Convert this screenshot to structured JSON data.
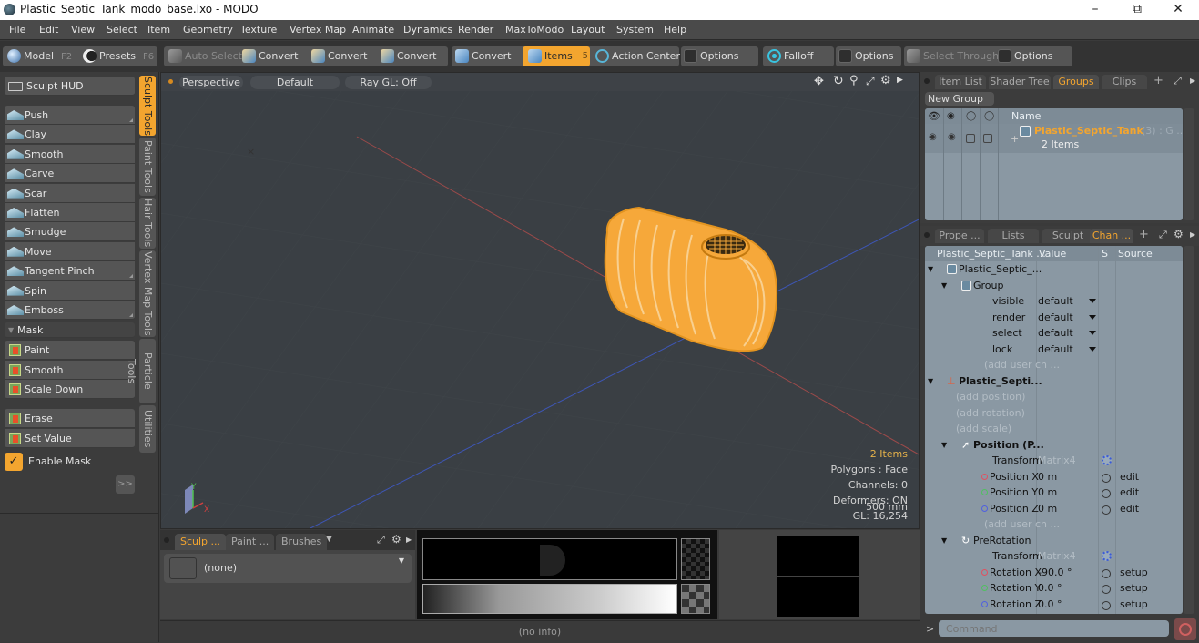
{
  "window": {
    "title": "Plastic_Septic_Tank_modo_base.lxo - MODO",
    "controls": [
      "minimize",
      "restore",
      "close"
    ]
  },
  "menubar": [
    "File",
    "Edit",
    "View",
    "Select",
    "Item",
    "Geometry",
    "Texture",
    "Vertex Map",
    "Animate",
    "Dynamics",
    "Render",
    "MaxToModo",
    "Layout",
    "System",
    "Help"
  ],
  "toolbar": {
    "model": {
      "label": "Model",
      "key": "F2"
    },
    "presets": {
      "label": "Presets",
      "key": "F6"
    },
    "auto_select": "Auto Select",
    "convert_buttons": [
      "Convert",
      "Convert",
      "Convert",
      "Convert"
    ],
    "items": {
      "label": "Items",
      "key": "5"
    },
    "action_center": "Action Center",
    "options1": "Options",
    "falloff": "Falloff",
    "options2": "Options",
    "select_through": "Select Through",
    "options3": "Options"
  },
  "left_panel": {
    "sculpt_hud": "Sculpt HUD",
    "tools": [
      "Push",
      "Clay",
      "Smooth",
      "Carve",
      "Scar",
      "Flatten",
      "Smudge",
      "Move",
      "Tangent Pinch",
      "Spin",
      "Emboss"
    ],
    "mask_header": "Mask",
    "mask_tools": [
      "Paint",
      "Smooth",
      "Scale Down"
    ],
    "mask_tools2": [
      "Erase",
      "Set Value"
    ],
    "enable_mask": {
      "label": "Enable Mask",
      "checked": true
    },
    "expand_label": ">>",
    "vertical_tabs": [
      {
        "label": "Sculpt Tools",
        "active": true
      },
      {
        "label": "Paint Tools",
        "active": false
      },
      {
        "label": "Hair Tools",
        "active": false
      },
      {
        "label": "Vertex Map Tools",
        "active": false
      },
      {
        "label": "Particle Tools",
        "active": false
      },
      {
        "label": "Utilities",
        "active": false
      }
    ]
  },
  "viewport": {
    "view_label": "Perspective",
    "shading_label": "Default",
    "raygl_label": "Ray GL: Off",
    "hud": {
      "items": "2 Items",
      "polygons": "Polygons : Face",
      "channels": "Channels: 0",
      "deformers": "Deformers: ON",
      "gl": "GL: 16,254",
      "scale": "500 mm"
    },
    "axis_labels": {
      "y": "Y",
      "x": "X"
    }
  },
  "bottom_panel": {
    "tabs": [
      {
        "label": "Sculp ...",
        "active": true
      },
      {
        "label": "Paint ...",
        "active": false
      },
      {
        "label": "Brushes",
        "active": false
      }
    ],
    "preset_value": "(none)"
  },
  "statusbar": {
    "info": "(no info)"
  },
  "groups_panel": {
    "tabs": [
      {
        "label": "Item List",
        "active": false
      },
      {
        "label": "Shader Tree",
        "active": false
      },
      {
        "label": "Groups",
        "active": true
      },
      {
        "label": "Clips",
        "active": false
      }
    ],
    "new_group": "New Group",
    "column_name": "Name",
    "group": {
      "name": "Plastic_Septic_Tank",
      "suffix": "(3) : G ...",
      "count": "2 Items"
    }
  },
  "channels_panel": {
    "tabs": [
      {
        "label": "Prope ...",
        "active": false
      },
      {
        "label": "Lists",
        "active": false
      },
      {
        "label": "Sculpt",
        "active": false
      },
      {
        "label": "Chan ...",
        "active": true
      }
    ],
    "columns": [
      "Plastic_Septic_Tank ...",
      "Value",
      "S",
      "Source"
    ],
    "rows": [
      {
        "name": "Plastic_Septic_...",
        "value": "",
        "s": "",
        "source": "",
        "type": "item",
        "indent": 1
      },
      {
        "name": "Group",
        "value": "",
        "s": "",
        "source": "",
        "type": "group",
        "indent": 2
      },
      {
        "name": "visible",
        "value": "default",
        "s": "",
        "source": "",
        "type": "dropdown",
        "indent": 3
      },
      {
        "name": "render",
        "value": "default",
        "s": "",
        "source": "",
        "type": "dropdown",
        "indent": 3
      },
      {
        "name": "select",
        "value": "default",
        "s": "",
        "source": "",
        "type": "dropdown",
        "indent": 3
      },
      {
        "name": "lock",
        "value": "default",
        "s": "",
        "source": "",
        "type": "dropdown",
        "indent": 3
      },
      {
        "name": "(add user ch ...",
        "value": "",
        "s": "",
        "source": "",
        "type": "add",
        "indent": 3
      },
      {
        "name": "Plastic_Septi...",
        "value": "",
        "s": "",
        "source": "",
        "type": "locator",
        "indent": 1
      },
      {
        "name": "(add position)",
        "value": "",
        "s": "",
        "source": "",
        "type": "add",
        "indent": 2
      },
      {
        "name": "(add rotation)",
        "value": "",
        "s": "",
        "source": "",
        "type": "add",
        "indent": 2
      },
      {
        "name": "(add scale)",
        "value": "",
        "s": "",
        "source": "",
        "type": "add",
        "indent": 2
      },
      {
        "name": "Position (P...",
        "value": "",
        "s": "",
        "source": "",
        "type": "xform",
        "indent": 2
      },
      {
        "name": "Transform",
        "value": "Matrix4",
        "s": "gear",
        "source": "",
        "type": "matrix",
        "indent": 3
      },
      {
        "name": "Position X",
        "value": "0 m",
        "s": "radio",
        "source": "edit",
        "type": "x",
        "indent": 3
      },
      {
        "name": "Position Y",
        "value": "0 m",
        "s": "radio",
        "source": "edit",
        "type": "y",
        "indent": 3
      },
      {
        "name": "Position Z",
        "value": "0 m",
        "s": "radio",
        "source": "edit",
        "type": "z",
        "indent": 3
      },
      {
        "name": "(add user ch ...",
        "value": "",
        "s": "",
        "source": "",
        "type": "add",
        "indent": 3
      },
      {
        "name": "PreRotation",
        "value": "",
        "s": "",
        "source": "",
        "type": "rot",
        "indent": 2
      },
      {
        "name": "Transform",
        "value": "Matrix4",
        "s": "gear",
        "source": "",
        "type": "matrix",
        "indent": 3
      },
      {
        "name": "Rotation X",
        "value": "-90.0 °",
        "s": "radio",
        "source": "setup",
        "type": "x",
        "indent": 3
      },
      {
        "name": "Rotation Y",
        "value": "0.0 °",
        "s": "radio",
        "source": "setup",
        "type": "y",
        "indent": 3
      },
      {
        "name": "Rotation Z",
        "value": "0.0 °",
        "s": "radio",
        "source": "setup",
        "type": "z",
        "indent": 3
      }
    ]
  },
  "command": {
    "placeholder": "Command",
    "prompt": ">"
  },
  "colors": {
    "accent": "#f3a52f",
    "selection": "#f6a83a",
    "list_bg": "#8a98a3",
    "x_axis": "#d04050",
    "y_axis": "#40c060",
    "z_axis": "#4050d0"
  }
}
